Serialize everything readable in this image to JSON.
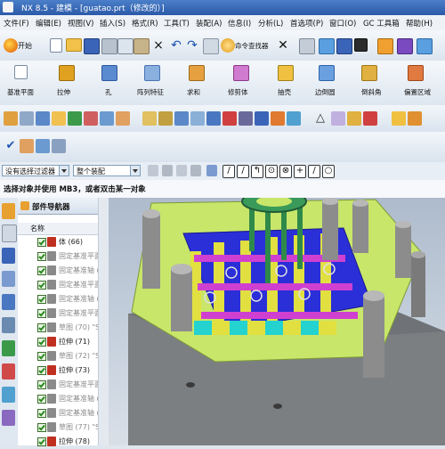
{
  "window": {
    "title": "NX 8.5 - 建模 - [guatao.prt（修改的）]"
  },
  "menu": {
    "items": [
      "文件(F)",
      "编辑(E)",
      "视图(V)",
      "插入(S)",
      "格式(R)",
      "工具(T)",
      "装配(A)",
      "信息(I)",
      "分析(L)",
      "首选项(P)",
      "窗口(O)",
      "GC 工具箱",
      "帮助(H)"
    ]
  },
  "toolbar": {
    "start_label": "开始",
    "command_finder_label": "命令查找器"
  },
  "features": {
    "labels": [
      "基准平面",
      "拉伸",
      "孔",
      "阵列特征",
      "求和",
      "修剪体",
      "抽壳",
      "边倒圆",
      "倒斜角",
      "偏置区域"
    ]
  },
  "filter": {
    "selection_filter": "没有选择过滤器",
    "assembly_scope": "整个装配"
  },
  "prompt": {
    "text": "选择对象并使用 MB3，或者双击某一对象"
  },
  "navigator": {
    "title": "部件导航器",
    "column_name": "名称",
    "rows": [
      {
        "label": "体 (66)",
        "icon": "body-icon",
        "color": "#c03020"
      },
      {
        "label": "固定基准平面",
        "icon": "datum-plane-icon",
        "color": "#8a8a8a"
      },
      {
        "label": "固定基准轴 (6",
        "icon": "datum-axis-icon",
        "color": "#8a8a8a"
      },
      {
        "label": "固定基准平面",
        "icon": "datum-plane-icon",
        "color": "#8a8a8a"
      },
      {
        "label": "固定基准轴 (6",
        "icon": "datum-axis-icon",
        "color": "#8a8a8a"
      },
      {
        "label": "固定基准平面",
        "icon": "datum-plane-icon",
        "color": "#8a8a8a"
      },
      {
        "label": "草图 (70) \"SKE",
        "icon": "sketch-icon",
        "color": "#8a8a8a"
      },
      {
        "label": "拉伸 (71)",
        "icon": "extrude-icon",
        "color": "#c03020"
      },
      {
        "label": "草图 (72) \"SKE",
        "icon": "sketch-icon",
        "color": "#8a8a8a"
      },
      {
        "label": "拉伸 (73)",
        "icon": "extrude-icon",
        "color": "#c03020"
      },
      {
        "label": "固定基准平面",
        "icon": "datum-plane-icon",
        "color": "#8a8a8a"
      },
      {
        "label": "固定基准轴 (7",
        "icon": "datum-axis-icon",
        "color": "#8a8a8a"
      },
      {
        "label": "固定基准轴 (7",
        "icon": "datum-axis-icon",
        "color": "#8a8a8a"
      },
      {
        "label": "草图 (77) \"SKE",
        "icon": "sketch-icon",
        "color": "#8a8a8a"
      },
      {
        "label": "拉伸 (78)",
        "icon": "extrude-icon",
        "color": "#c03020"
      }
    ]
  },
  "colors": {
    "title_bar": "#2b5aa8",
    "mold_plate": "#c8e66a",
    "cavity_blue": "#2a2fd8",
    "insert_cyan": "#24d2d0",
    "pillar_gray": "#8c8c8c",
    "runner_green": "#2f8a4a"
  }
}
